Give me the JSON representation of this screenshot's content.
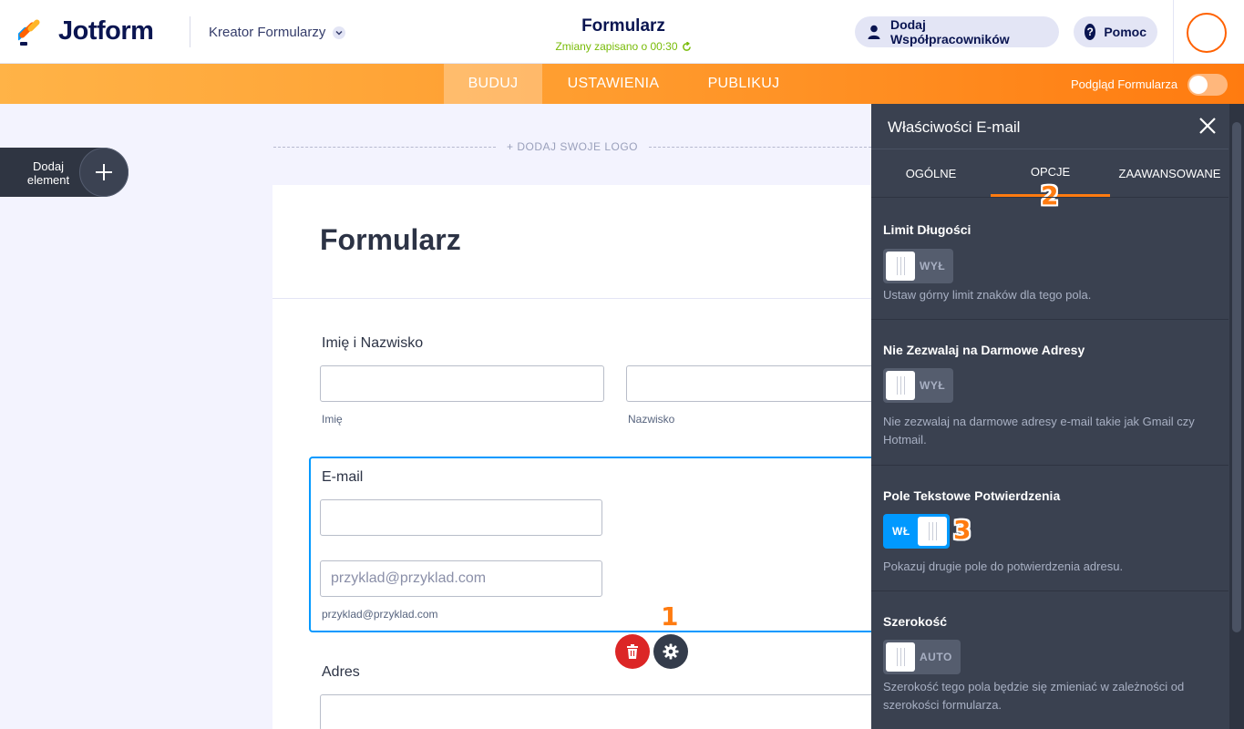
{
  "header": {
    "logo_text": "Jotform",
    "builder_menu": "Kreator Formularzy",
    "form_title": "Formularz",
    "save_status": "Zmiany zapisano o 00:30",
    "collab_button": "Dodaj Współpracowników",
    "help_button": "Pomoc",
    "help_glyph": "?"
  },
  "nav": {
    "tabs": [
      "BUDUJ",
      "USTAWIENIA",
      "PUBLIKUJ"
    ],
    "active_tab": "BUDUJ",
    "preview_label": "Podgląd Formularza",
    "preview_on": false
  },
  "left": {
    "add_element_label": "Dodaj element"
  },
  "canvas": {
    "logo_placeholder": "+ DODAJ SWOJE LOGO",
    "form_heading": "Formularz",
    "name_field": {
      "label": "Imię i Nazwisko",
      "first_sublabel": "Imię",
      "last_sublabel": "Nazwisko",
      "first_value": "",
      "last_value": ""
    },
    "email_field": {
      "label": "E-mail",
      "value": "",
      "confirm_placeholder": "przyklad@przyklad.com",
      "sublabel": "przyklad@przyklad.com"
    },
    "address_field": {
      "label": "Adres"
    }
  },
  "panel": {
    "title": "Właściwości E-mail",
    "tabs": [
      "OGÓLNE",
      "OPCJE",
      "ZAAWANSOWANE"
    ],
    "active_tab": "OPCJE",
    "sections": [
      {
        "title": "Limit Długości",
        "toggle": "WYŁ",
        "on": false,
        "desc": "Ustaw górny limit znaków dla tego pola."
      },
      {
        "title": "Nie Zezwalaj na Darmowe Adresy",
        "toggle": "WYŁ",
        "on": false,
        "desc": "Nie zezwalaj na darmowe adresy e-mail takie jak Gmail czy Hotmail."
      },
      {
        "title": "Pole Tekstowe Potwierdzenia",
        "toggle": "WŁ",
        "on": true,
        "desc": "Pokazuj drugie pole do potwierdzenia adresu."
      },
      {
        "title": "Szerokość",
        "toggle": "AUTO",
        "on": false,
        "desc": "Szerokość tego pola będzie się zmieniać w zależności od szerokości formularza."
      }
    ]
  },
  "annotations": {
    "step1": "1",
    "step2": "2",
    "step3": "3"
  },
  "colors": {
    "brand_orange": "#ff7b10",
    "selection_blue": "#0099ff",
    "panel_bg": "#3a4150",
    "delete_red": "#dc2626",
    "saved_green": "#78bb07"
  },
  "icons": {
    "logo": "jotform-logo-icon",
    "builder_chevron": "chevron-down-icon",
    "collab": "user-icon",
    "help": "help-icon",
    "refresh": "refresh-icon",
    "add": "plus-icon",
    "delete": "trash-icon",
    "settings": "gear-icon",
    "close": "close-icon"
  }
}
